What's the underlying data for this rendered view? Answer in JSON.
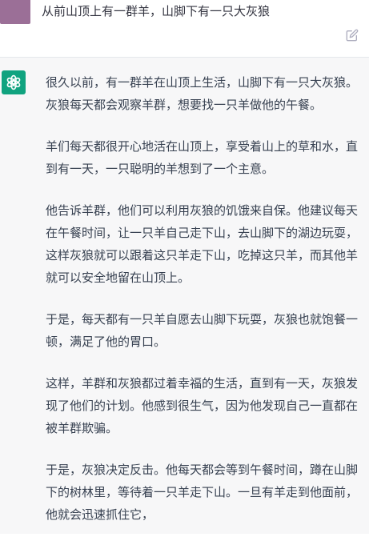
{
  "user_message": {
    "text": "从前山顶上有一群羊，山脚下有一只大灰狼",
    "edit_icon": "edit-icon"
  },
  "assistant_message": {
    "avatar_icon": "openai-logo-icon",
    "paragraphs": [
      "很久以前，有一群羊在山顶上生活，山脚下有一只大灰狼。灰狼每天都会观察羊群，想要找一只羊做他的午餐。",
      "羊们每天都很开心地活在山顶上，享受着山上的草和水，直到有一天，一只聪明的羊想到了一个主意。",
      "他告诉羊群，他们可以利用灰狼的饥饿来自保。他建议每天在午餐时间，让一只羊自己走下山，去山脚下的湖边玩耍，这样灰狼就可以跟着这只羊走下山，吃掉这只羊，而其他羊就可以安全地留在山顶上。",
      "于是，每天都有一只羊自愿去山脚下玩耍，灰狼也就饱餐一顿，满足了他的胃口。",
      "这样，羊群和灰狼都过着幸福的生活，直到有一天，灰狼发现了他们的计划。他感到很生气，因为他发现自己一直都在被羊群欺骗。",
      "于是，灰狼决定反击。他每天都会等到午餐时间，蹲在山脚下的树林里，等待着一只羊走下山。一旦有羊走到他面前，他就会迅速抓住它，"
    ]
  },
  "colors": {
    "user_bg": "#ffffff",
    "assistant_bg": "#f7f7f8",
    "avatar_user": "#9b6f97",
    "avatar_bot": "#10a37f",
    "text": "#374151"
  }
}
